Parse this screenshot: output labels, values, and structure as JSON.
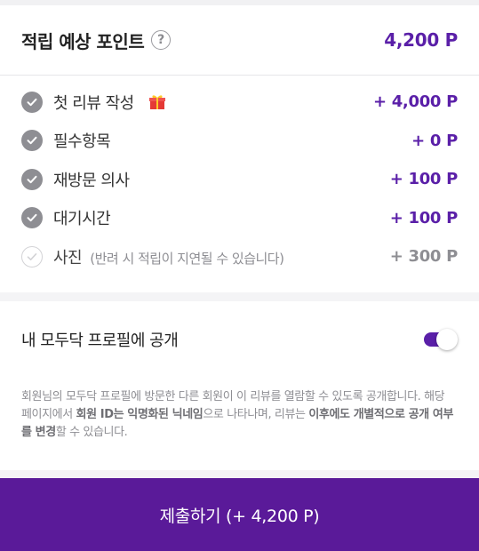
{
  "header": {
    "title": "적립 예상 포인트",
    "total": "4,200 P"
  },
  "items": [
    {
      "label": "첫 리뷰 작성",
      "points": "+ 4,000 P",
      "checked": true,
      "badge_icon": "gift-icon"
    },
    {
      "label": "필수항목",
      "points": "+ 0 P",
      "checked": true
    },
    {
      "label": "재방문 의사",
      "points": "+ 100 P",
      "checked": true
    },
    {
      "label": "대기시간",
      "points": "+ 100 P",
      "checked": true
    },
    {
      "label": "사진",
      "sub": "(반려 시 적립이 지연될 수 있습니다)",
      "points": "+ 300 P",
      "checked": false
    }
  ],
  "profile": {
    "title": "내 모두닥 프로필에 공개",
    "toggle_on": true,
    "notice": {
      "p1": "회원님의 모두닥 프로필에 방문한 다른 회원이 이 리뷰를 열람할 수 있도록 공개합니다. 해당 페이지에서 ",
      "b1": "회원 ID는 익명화된 닉네임",
      "p2": "으로 나타나며, 리뷰는 ",
      "b2": "이후에도 개별적으로 공개 여부를 변경",
      "p3": "할 수 있습니다."
    }
  },
  "submit_label": "제출하기 (+ 4,200 P)",
  "colors": {
    "accent": "#5a1fa8",
    "button": "#5a1a99",
    "muted": "#8e8e93"
  }
}
